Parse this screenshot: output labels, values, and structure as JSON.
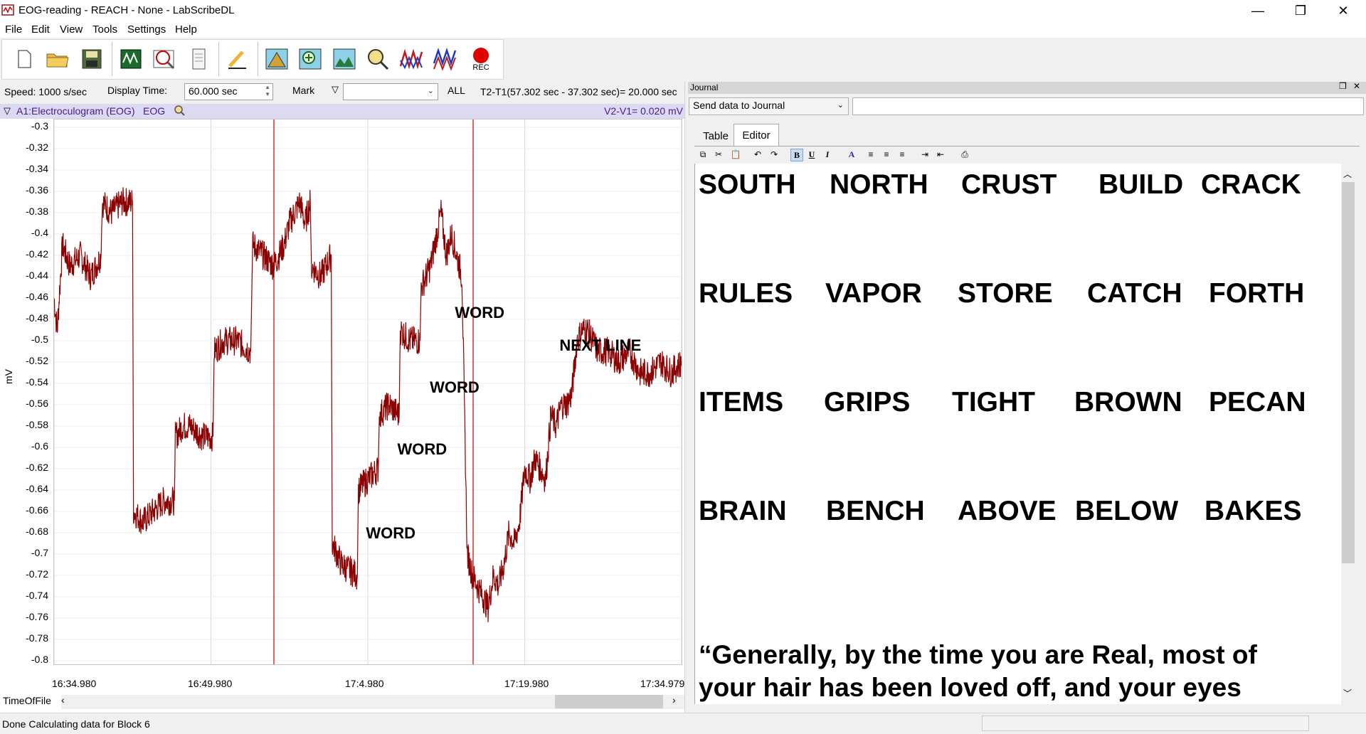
{
  "window": {
    "title": "EOG-reading - REACH  - None - LabScribeDL",
    "minimize": "—",
    "maximize": "❐",
    "close": "✕"
  },
  "menu": [
    "File",
    "Edit",
    "View",
    "Tools",
    "Settings",
    "Help"
  ],
  "toolbar": {
    "rec_label": "REC",
    "icons": [
      "new-file-icon",
      "open-folder-icon",
      "save-icon",
      "main-window-icon",
      "analysis-icon",
      "journal-icon",
      "marker-pen-icon",
      "mountain-icon",
      "zoom-add-icon",
      "landscape-icon",
      "find-icon",
      "waveform-icon",
      "waveform-double-icon",
      "record-icon"
    ]
  },
  "controls": {
    "speed": "Speed: 1000 s/sec",
    "display_time_label": "Display Time:",
    "display_time_value": "60.000 sec",
    "mark_label": "Mark",
    "mark_value": "",
    "all_label": "ALL",
    "t2t1": "T2-T1(57.302 sec - 37.302 sec)= 20.000 sec"
  },
  "channel": {
    "name": "A1:Electroculogram (EOG)",
    "short": "EOG",
    "v2v1": "V2-V1= 0.020 mV"
  },
  "chart_data": {
    "type": "line",
    "ylabel": "mV",
    "xlabel": "TimeOfFile",
    "ylim": [
      -0.81,
      -0.3
    ],
    "y_ticks": [
      "-0.3",
      "-0.32",
      "-0.34",
      "-0.36",
      "-0.38",
      "-0.4",
      "-0.42",
      "-0.44",
      "-0.46",
      "-0.48",
      "-0.5",
      "-0.52",
      "-0.54",
      "-0.56",
      "-0.58",
      "-0.6",
      "-0.62",
      "-0.64",
      "-0.66",
      "-0.68",
      "-0.7",
      "-0.72",
      "-0.74",
      "-0.76",
      "-0.78",
      "-0.8"
    ],
    "x_ticks": [
      "16:34.980",
      "16:49.980",
      "17:4.980",
      "17:19.980",
      "17:34.979"
    ],
    "xlim": [
      0,
      60
    ],
    "grid": true,
    "series_color": "#8b0000",
    "cursor_color": "#d00000",
    "cursors": [
      20.0,
      40.0
    ],
    "series": [
      {
        "x": [
          0,
          0.3,
          0.8,
          1.5,
          2.5,
          3.5,
          4.5,
          4.6,
          5.5,
          6.5,
          7.5,
          7.6,
          8.5,
          9.5,
          10.5,
          11.5,
          11.6,
          12.3,
          13.0,
          14.2,
          15.2,
          15.3,
          16.2,
          17.5,
          18.8,
          19.0,
          20.0,
          21.0,
          22.0,
          22.5,
          23.5,
          24.0,
          24.5,
          24.6,
          25.5,
          26.5,
          26.6,
          27.5,
          29.0,
          29.1,
          30.0,
          31.0,
          31.1,
          32.0,
          33.0,
          33.1,
          34.0,
          35.0,
          35.1,
          36.0,
          37.0,
          37.5,
          38.0,
          38.5,
          39.0,
          39.5,
          40.0,
          40.5,
          41.0,
          41.5,
          42.0,
          42.5,
          43.0,
          43.5,
          44.0,
          44.5,
          45.0,
          45.5,
          46.0,
          46.5,
          47.0,
          47.5,
          48.0,
          48.5,
          49.0,
          49.5,
          50.0,
          50.5,
          51.0,
          51.5,
          52.0,
          53.0,
          54.0,
          55.0,
          56.0,
          57.0,
          58.0,
          59.0,
          60.0
        ],
        "y": [
          -0.46,
          -0.49,
          -0.41,
          -0.43,
          -0.42,
          -0.44,
          -0.42,
          -0.37,
          -0.38,
          -0.37,
          -0.37,
          -0.66,
          -0.67,
          -0.66,
          -0.65,
          -0.65,
          -0.59,
          -0.58,
          -0.58,
          -0.59,
          -0.59,
          -0.51,
          -0.5,
          -0.5,
          -0.51,
          -0.41,
          -0.42,
          -0.43,
          -0.41,
          -0.39,
          -0.37,
          -0.39,
          -0.37,
          -0.43,
          -0.44,
          -0.42,
          -0.69,
          -0.71,
          -0.72,
          -0.64,
          -0.63,
          -0.62,
          -0.57,
          -0.56,
          -0.57,
          -0.49,
          -0.5,
          -0.5,
          -0.45,
          -0.43,
          -0.38,
          -0.42,
          -0.4,
          -0.42,
          -0.44,
          -0.7,
          -0.72,
          -0.73,
          -0.74,
          -0.75,
          -0.72,
          -0.73,
          -0.71,
          -0.68,
          -0.69,
          -0.67,
          -0.62,
          -0.63,
          -0.61,
          -0.62,
          -0.63,
          -0.57,
          -0.58,
          -0.56,
          -0.56,
          -0.55,
          -0.5,
          -0.49,
          -0.49,
          -0.5,
          -0.51,
          -0.51,
          -0.52,
          -0.51,
          -0.53,
          -0.53,
          -0.52,
          -0.53,
          -0.52
        ]
      }
    ],
    "annotations": [
      {
        "text": "WORD",
        "x": 40.5,
        "y": -0.475
      },
      {
        "text": "WORD",
        "x": 38.1,
        "y": -0.545
      },
      {
        "text": "WORD",
        "x": 35.0,
        "y": -0.603
      },
      {
        "text": "WORD",
        "x": 32.0,
        "y": -0.682
      },
      {
        "text": "NEXT LINE",
        "x": 50.5,
        "y": -0.506
      }
    ]
  },
  "bottom": {
    "timeoffile": "TimeOfFile",
    "status": "Done Calculating data for Block 6"
  },
  "journal": {
    "title": "Journal",
    "send_select": "Send data to Journal",
    "send_input": "",
    "tabs": [
      "Table",
      "Editor"
    ],
    "active_tab": "Editor",
    "editor_tools": [
      "copy-icon",
      "cut-icon",
      "paste-icon",
      "undo-icon",
      "redo-icon",
      "B",
      "U",
      "I",
      "A",
      "align-left-icon",
      "align-center-icon",
      "align-right-icon",
      "indent-icon",
      "outdent-icon",
      "print-icon"
    ],
    "rows": [
      [
        "SOUTH",
        "NORTH",
        "CRUST",
        "BUILD",
        "CRACK"
      ],
      [
        "RULES",
        "VAPOR",
        "STORE",
        "CATCH",
        "FORTH"
      ],
      [
        "ITEMS",
        "GRIPS",
        "TIGHT",
        "BROWN",
        "PECAN"
      ],
      [
        "BRAIN",
        "BENCH",
        "ABOVE",
        "BELOW",
        "BAKES"
      ]
    ],
    "quote_line1": "“Generally, by the time you are Real, most of",
    "quote_line2": "your hair has been loved off, and your eyes"
  }
}
